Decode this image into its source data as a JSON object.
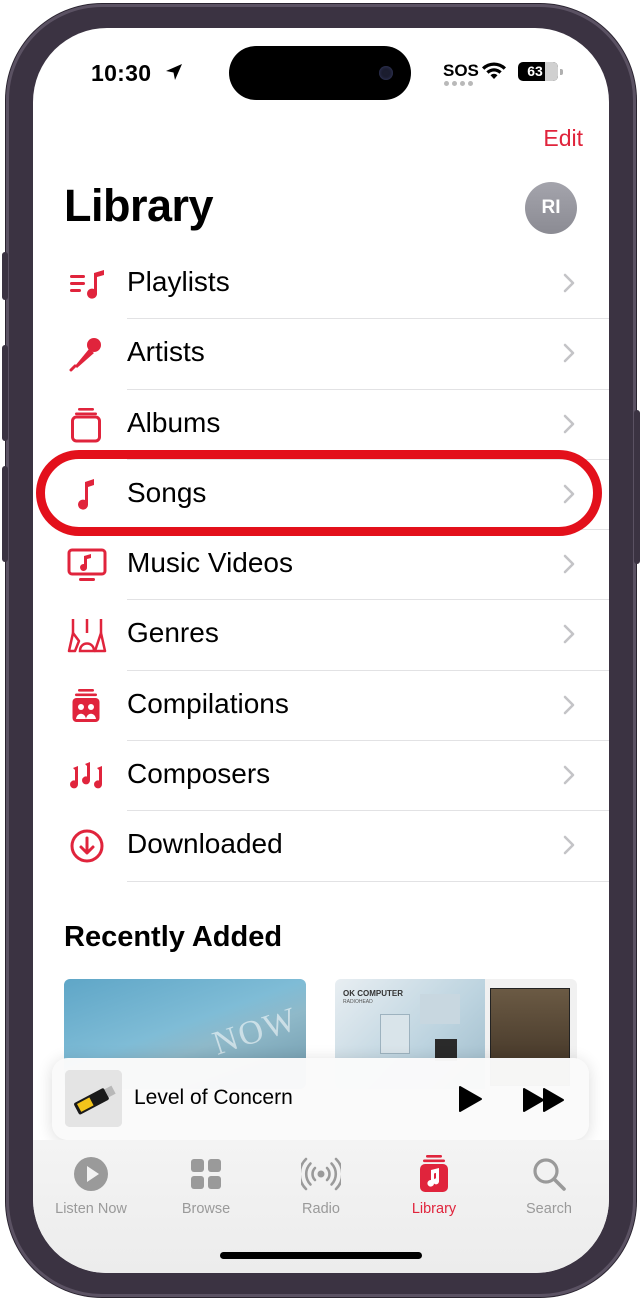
{
  "status_bar": {
    "time": "10:30",
    "carrier_status": "SOS",
    "battery": "63"
  },
  "header": {
    "edit_label": "Edit",
    "title": "Library",
    "avatar_initials": "RI"
  },
  "library_items": [
    {
      "label": "Playlists",
      "icon": "playlists-icon"
    },
    {
      "label": "Artists",
      "icon": "microphone-icon"
    },
    {
      "label": "Albums",
      "icon": "album-stack-icon"
    },
    {
      "label": "Songs",
      "icon": "music-note-icon"
    },
    {
      "label": "Music Videos",
      "icon": "music-video-icon"
    },
    {
      "label": "Genres",
      "icon": "guitars-icon"
    },
    {
      "label": "Compilations",
      "icon": "compilations-icon"
    },
    {
      "label": "Composers",
      "icon": "composers-icon"
    },
    {
      "label": "Downloaded",
      "icon": "download-circle-icon"
    }
  ],
  "recently_added": {
    "title": "Recently Added"
  },
  "mini_player": {
    "track_title": "Level of Concern"
  },
  "tab_bar": [
    {
      "label": "Listen Now",
      "icon": "play-circle-icon",
      "active": false
    },
    {
      "label": "Browse",
      "icon": "grid-icon",
      "active": false
    },
    {
      "label": "Radio",
      "icon": "radio-waves-icon",
      "active": false
    },
    {
      "label": "Library",
      "icon": "library-icon",
      "active": true
    },
    {
      "label": "Search",
      "icon": "search-icon",
      "active": false
    }
  ],
  "colors": {
    "accent": "#e0243c",
    "highlight_ring": "#e3101b",
    "tab_inactive": "#9a9a9a"
  }
}
